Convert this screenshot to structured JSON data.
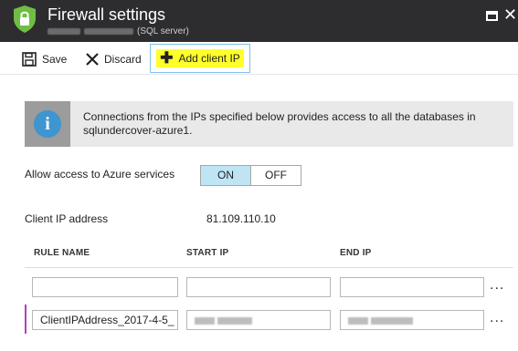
{
  "header": {
    "title": "Firewall settings",
    "subtitle_suffix": "(SQL server)",
    "icon": "shield-lock-icon",
    "accent": "#2d2d2f"
  },
  "toolbar": {
    "save_label": "Save",
    "discard_label": "Discard",
    "add_client_ip_label": "Add client IP",
    "highlight_color": "#ffff2a"
  },
  "info": {
    "icon": "info-icon",
    "text": "Connections from the IPs specified below provides access to all the databases in sqlundercover-azure1."
  },
  "azure_access": {
    "label": "Allow access to Azure services",
    "on_label": "ON",
    "off_label": "OFF",
    "selected": "ON"
  },
  "client_ip": {
    "label": "Client IP address",
    "value": "81.109.110.10"
  },
  "rules_table": {
    "columns": [
      "RULE NAME",
      "START IP",
      "END IP"
    ],
    "rows": [
      {
        "rule_name": "",
        "start_ip": "",
        "end_ip": ""
      },
      {
        "rule_name": "ClientIPAddress_2017-4-5_",
        "start_ip": "",
        "end_ip": ""
      }
    ],
    "more_label": "..."
  }
}
